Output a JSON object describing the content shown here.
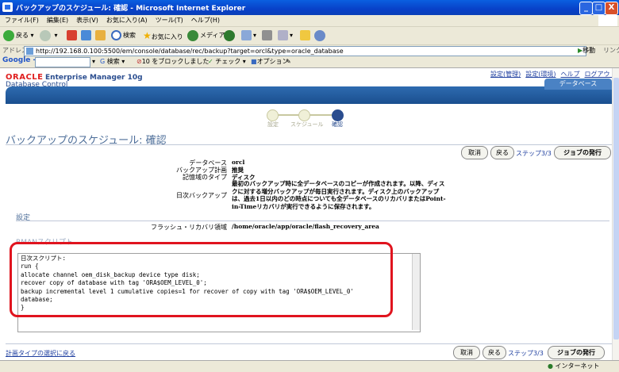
{
  "window": {
    "title": "バックアップのスケジュール: 確認 - Microsoft Internet Explorer",
    "buttons": [
      "_",
      "□",
      "X"
    ]
  },
  "menu": [
    "ファイル(F)",
    "編集(E)",
    "表示(V)",
    "お気に入り(A)",
    "ツール(T)",
    "ヘルプ(H)"
  ],
  "toolbar": {
    "back": "戻る",
    "search": "検索",
    "favorites": "お気に入り",
    "media": "メディア"
  },
  "address": {
    "label": "アドレス(D)",
    "url": "http://192.168.0.100:5500/em/console/database/rec/backup?target=orcl&type=oracle_database",
    "go": "移動",
    "links": "リンク »"
  },
  "googlebar": {
    "logo": "Google -",
    "search": "検索",
    "blocked": "10 をブロックしました",
    "check": "チェック",
    "options": "オプション"
  },
  "em": {
    "logo": "ORACLE",
    "title": "Enterprise Manager 10g",
    "subtitle": "Database Control",
    "links": [
      "設定(管理)",
      "設定(環境)",
      "ヘルプ",
      "ログアウト"
    ],
    "tab": "データベース"
  },
  "train": {
    "steps": [
      "設定",
      "スケジュール",
      "確認"
    ],
    "current": 2
  },
  "page": {
    "title": "バックアップのスケジュール: 確認",
    "cancel": "取消",
    "back": "戻る",
    "step": "ステップ3/3",
    "submit": "ジョブの発行"
  },
  "summary": {
    "rows": [
      {
        "label": "データベース",
        "value": "orcl"
      },
      {
        "label": "バックアップ計画",
        "value": "推奨"
      },
      {
        "label": "記憶域のタイプ",
        "value": "ディスク"
      }
    ],
    "daily_label": "日次バックアップ",
    "daily_value": [
      "最初のバックアップ時に全データベースのコピーが作成されます。以降、ディス",
      "クに対する増分バックアップが毎日実行されます。ディスク上のバックアップ",
      "は、過去1日以内のどの時点についても全データベースのリカバリまたはPoint-",
      "in-Timeリカバリが実行できるように保存されます。"
    ]
  },
  "settings": {
    "header": "設定",
    "flash_label": "フラッシュ・リカバリ領域",
    "flash_value": "/home/oracle/app/oracle/flash_recovery_area"
  },
  "rman": {
    "header": "RMANスクリプト",
    "lines": [
      "日次スクリプト:",
      "run {",
      "allocate channel oem_disk_backup device type disk;",
      "recover copy of database with tag 'ORA$OEM_LEVEL_0';",
      "backup incremental level 1 cumulative  copies=1 for recover of copy with tag 'ORA$OEM_LEVEL_0'",
      "database;",
      "}"
    ]
  },
  "footer": {
    "back_link": "計画タイプの選択に戻る"
  },
  "status": {
    "zone": "インターネット"
  }
}
